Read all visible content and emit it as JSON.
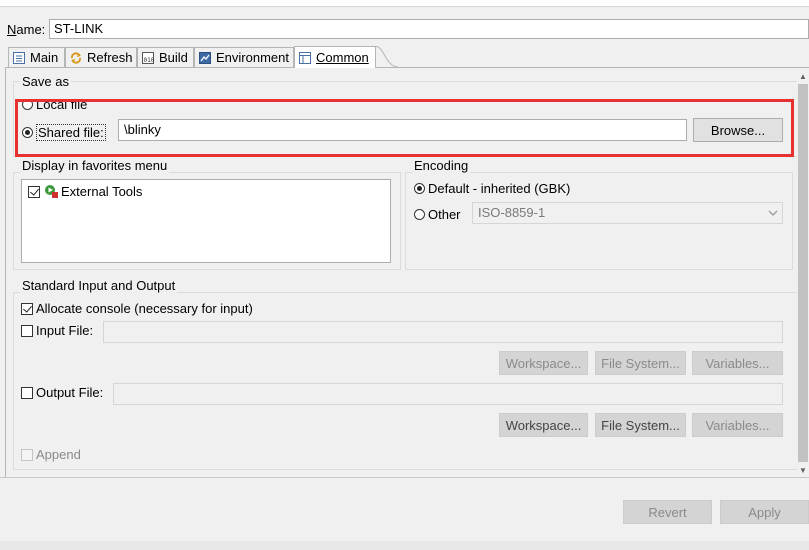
{
  "name": {
    "label": "Name:",
    "value": "ST-LINK"
  },
  "tabs": [
    {
      "label": "Main",
      "icon": "main-tab-icon"
    },
    {
      "label": "Refresh",
      "icon": "refresh-icon"
    },
    {
      "label": "Build",
      "icon": "build-icon"
    },
    {
      "label": "Environment",
      "icon": "environment-icon"
    },
    {
      "label": "Common",
      "icon": "common-tab-icon",
      "active": true
    }
  ],
  "save_as": {
    "title": "Save as",
    "local_file_label": "Local file",
    "shared_file_label": "Shared file:",
    "shared_file_value": "\\blinky",
    "browse_label": "Browse..."
  },
  "favorites": {
    "title": "Display in favorites menu",
    "items": [
      {
        "label": "External Tools",
        "checked": true
      }
    ]
  },
  "encoding": {
    "title": "Encoding",
    "default_label": "Default - inherited (GBK)",
    "other_label": "Other",
    "other_value": "ISO-8859-1"
  },
  "std_io": {
    "title": "Standard Input and Output",
    "allocate_console_label": "Allocate console (necessary for input)",
    "input_file_label": "Input File:",
    "output_file_label": "Output File:",
    "workspace_label": "Workspace...",
    "file_system_label": "File System...",
    "variables_label": "Variables...",
    "append_label": "Append"
  },
  "footer": {
    "revert_label": "Revert",
    "apply_label": "Apply"
  },
  "colors": {
    "highlight": "#e83030",
    "panel_bg": "#f0f0f0"
  }
}
